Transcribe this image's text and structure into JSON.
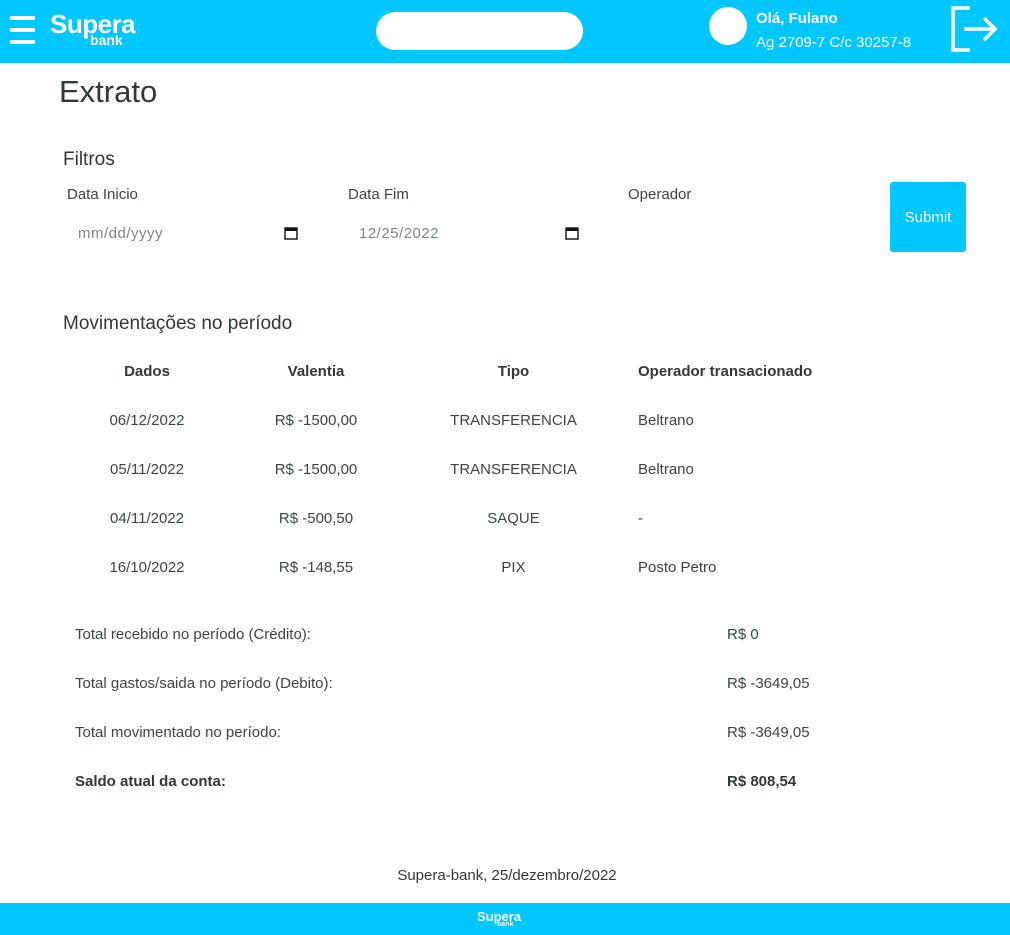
{
  "header": {
    "brand_main": "Supera",
    "brand_sub": "bank",
    "search": {
      "value": "",
      "placeholder": ""
    },
    "greeting": "Olá, Fulano",
    "account": "Ag 2709-7 C/c 30257-8",
    "icons": {
      "menu": "hamburger-icon",
      "logout": "logout-icon",
      "avatar": "avatar"
    }
  },
  "page": {
    "title": "Extrato"
  },
  "filters": {
    "title": "Filtros",
    "start_label": "Data Inicio",
    "start_value": "mm/dd/yyyy",
    "end_label": "Data Fim",
    "end_value": "12/25/2022",
    "operator_label": "Operador",
    "operator_value": "",
    "submit_label": "Submit"
  },
  "movements": {
    "title": "Movimentações no período",
    "columns": [
      "Dados",
      "Valentia",
      "Tipo",
      "Operador transacionado"
    ],
    "rows": [
      {
        "date": "06/12/2022",
        "value": "R$ -1500,00",
        "type": "TRANSFERENCIA",
        "operator": "Beltrano"
      },
      {
        "date": "05/11/2022",
        "value": "R$ -1500,00",
        "type": "TRANSFERENCIA",
        "operator": "Beltrano"
      },
      {
        "date": "04/11/2022",
        "value": "R$ -500,50",
        "type": "SAQUE",
        "operator": "-"
      },
      {
        "date": "16/10/2022",
        "value": "R$ -148,55",
        "type": "PIX",
        "operator": "Posto Petro"
      }
    ]
  },
  "summary": {
    "received_label": "Total recebido no período (Crédito):",
    "received_value": "R$ 0",
    "spent_label": "Total gastos/saida no período (Debito):",
    "spent_value": "R$ -3649,05",
    "moved_label": "Total movimentado no período:",
    "moved_value": "R$ -3649,05",
    "balance_label": "Saldo atual da conta:",
    "balance_value": "R$ 808,54"
  },
  "footer": {
    "text": "Supera-bank, 25/dezembro/2022",
    "brand_main": "Supera",
    "brand_sub": "bank"
  },
  "colors": {
    "accent": "#00c8ff",
    "text": "#2e3a3a",
    "background": "#ffffff"
  }
}
